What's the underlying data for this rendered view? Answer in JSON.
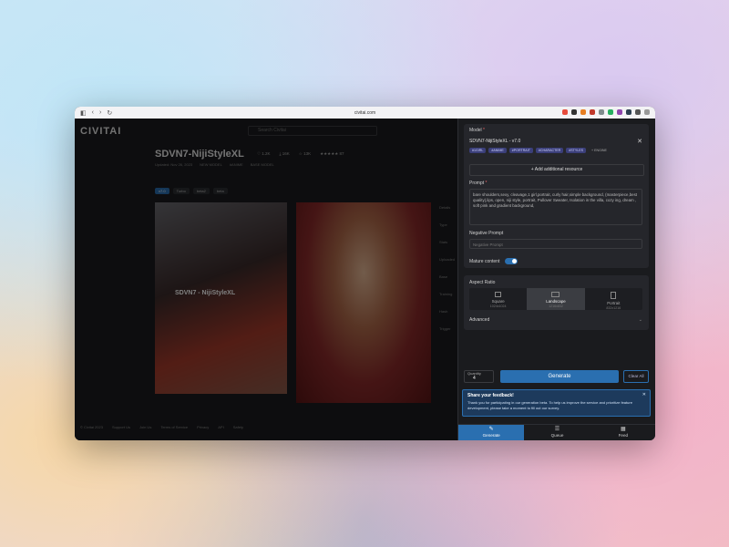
{
  "browser": {
    "url": "civitai.com",
    "nav": [
      "◧",
      "‹",
      "›",
      "↻"
    ]
  },
  "site": {
    "logo": "CIVITAI",
    "search_placeholder": "Search Civitai",
    "model_title": "SDVN7-NijiStyleXL",
    "stats": [
      "♡ 1.2K",
      "⤓ 16K",
      "☆ 13K",
      "★★★★★ 87"
    ],
    "subline": [
      "Updated: Nov 26, 2023",
      "NEW MODEL",
      "#ANIME",
      "BASE MODEL"
    ],
    "tags": [
      "v7.0",
      "Turbo",
      "beta2",
      "beta"
    ],
    "image_label": "SDVN7 - NijiStyleXL",
    "footer": [
      "© Civitai 2023",
      "Support Us",
      "Join Us",
      "Terms of Service",
      "Privacy",
      "API",
      "Safety"
    ],
    "right_labels": [
      "Details",
      "Type",
      "Stats",
      "Uploaded",
      "Base",
      "Training",
      "Hash",
      "Trigger"
    ]
  },
  "panel": {
    "model_label": "Model",
    "model_name": "SDVN7-NijiStyleXL - v7.0",
    "pills": [
      "#1GIRL",
      "#ANIME",
      "#PORTRAIT",
      "#CHARACTER",
      "#STYLES",
      "+ ENGINE"
    ],
    "add_resource": "Add additional resource",
    "prompt_label": "Prompt",
    "prompt_text": "bare shoulders,sexy, cleavage,1 girl,portrait, curly hair,simple background, (masterpiece,best quality),lips, open, niji style, portrait, Pullover Sweater, Isolation in the villa, cozy ing, dream , soft pink and gradient background,",
    "negative_label": "Negative Prompt",
    "negative_placeholder": "Negative Prompt",
    "mature_label": "Mature content",
    "aspect_label": "Aspect Ratio",
    "aspect_options": [
      {
        "name": "Square",
        "dims": "1024x1024"
      },
      {
        "name": "Landscape",
        "dims": "1216x832"
      },
      {
        "name": "Portrait",
        "dims": "832x1216"
      }
    ],
    "advanced_label": "Advanced",
    "quantity_label": "Quantity",
    "quantity_value": "4",
    "generate_label": "Generate",
    "clear_label": "Clear All",
    "feedback_title": "Share your feedback!",
    "feedback_body": "Thank you for participating in our generation beta. To help us improve the service and prioritize feature development, please take a moment to fill out our survey.",
    "tabs": [
      {
        "label": "Generate",
        "icon": "✎"
      },
      {
        "label": "Queue",
        "icon": "☰"
      },
      {
        "label": "Feed",
        "icon": "▦"
      }
    ]
  },
  "colors": {
    "accent": "#2a6fb0",
    "panel_bg": "#1a1b1e",
    "card_bg": "#25262b"
  }
}
